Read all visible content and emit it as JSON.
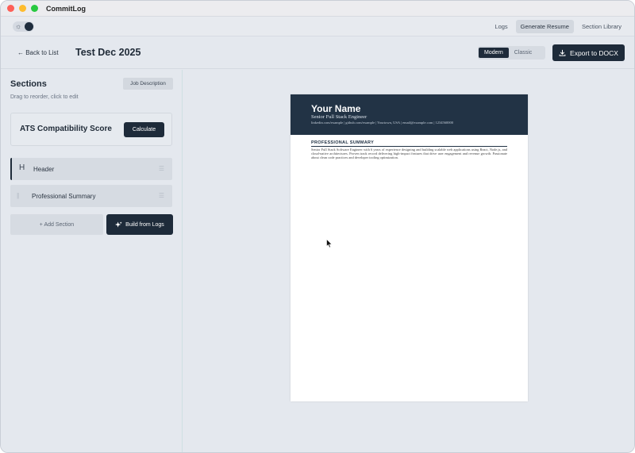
{
  "app": {
    "title": "CommitLog"
  },
  "nav": {
    "links": [
      {
        "label": "Logs",
        "active": false
      },
      {
        "label": "Generate Resume",
        "active": true
      },
      {
        "label": "Section Library",
        "active": false
      }
    ]
  },
  "header": {
    "back_label": "← Back to List",
    "page_title": "Test Dec 2025",
    "style_options": [
      "Modern",
      "Classic"
    ],
    "style_selected": "Modern",
    "export_label": "Export to DOCX"
  },
  "sidebar": {
    "title": "Sections",
    "subtitle": "Drag to reorder, click to edit",
    "job_description_label": "Job Description",
    "ats": {
      "title": "ATS Compatibility Score",
      "button": "Calculate"
    },
    "sections": [
      {
        "icon": "H",
        "label": "Header"
      },
      {
        "icon": "||",
        "label": "Professional Summary"
      }
    ],
    "add_section_label": "+ Add Section",
    "build_label": "Build from Logs"
  },
  "resume": {
    "name": "Your Name",
    "role": "Senior Full Stack Engineer",
    "contact": "linkedin.com/example  |  github.com/example  |  Yourtown, USA  |  email@example.com  |  1234560000",
    "summary_title": "PROFESSIONAL SUMMARY",
    "summary_text": "Senior Full Stack Software Engineer with 6 years of experience designing and building scalable web applications using React, Node.js, and cloud-native architectures. Proven track record delivering high-impact features that drive user engagement and revenue growth. Passionate about clean code practices and developer tooling optimization."
  },
  "colors": {
    "accent": "#1e2b3a",
    "resume_header": "#223345"
  }
}
